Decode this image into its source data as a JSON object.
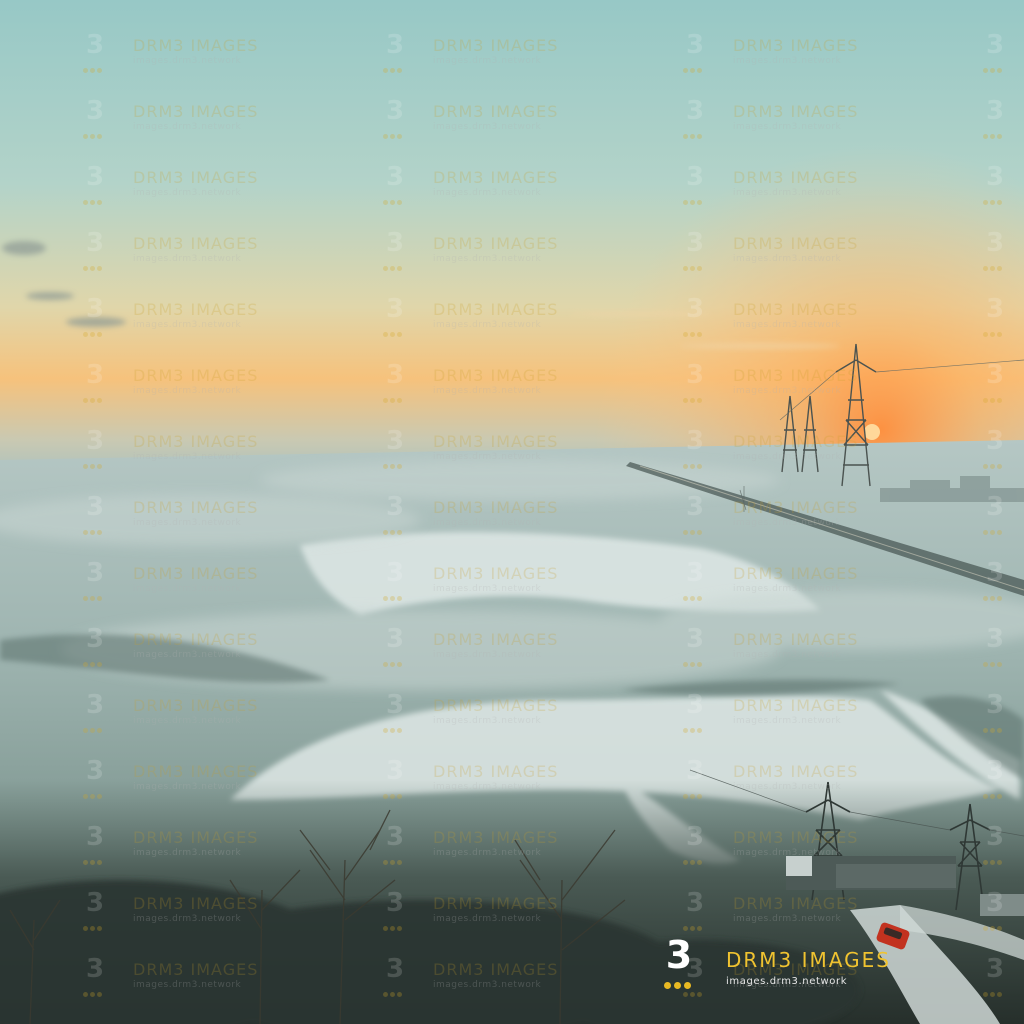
{
  "watermark": {
    "number": "3",
    "text": "DRM3 IMAGES",
    "url": "images.drm3.network"
  },
  "brand": {
    "number": "3",
    "text": "DRM3 IMAGES",
    "url": "images.drm3.network",
    "accent_color": "#f0c330"
  },
  "scene": {
    "description_colors": {
      "sky_top": "#9cc9c6",
      "sky_horizon": "#f6c27c",
      "sun": "#ff9a45",
      "fog": "#a9bdb9",
      "water": "#d6e2e0",
      "ground": "#33423d"
    }
  }
}
